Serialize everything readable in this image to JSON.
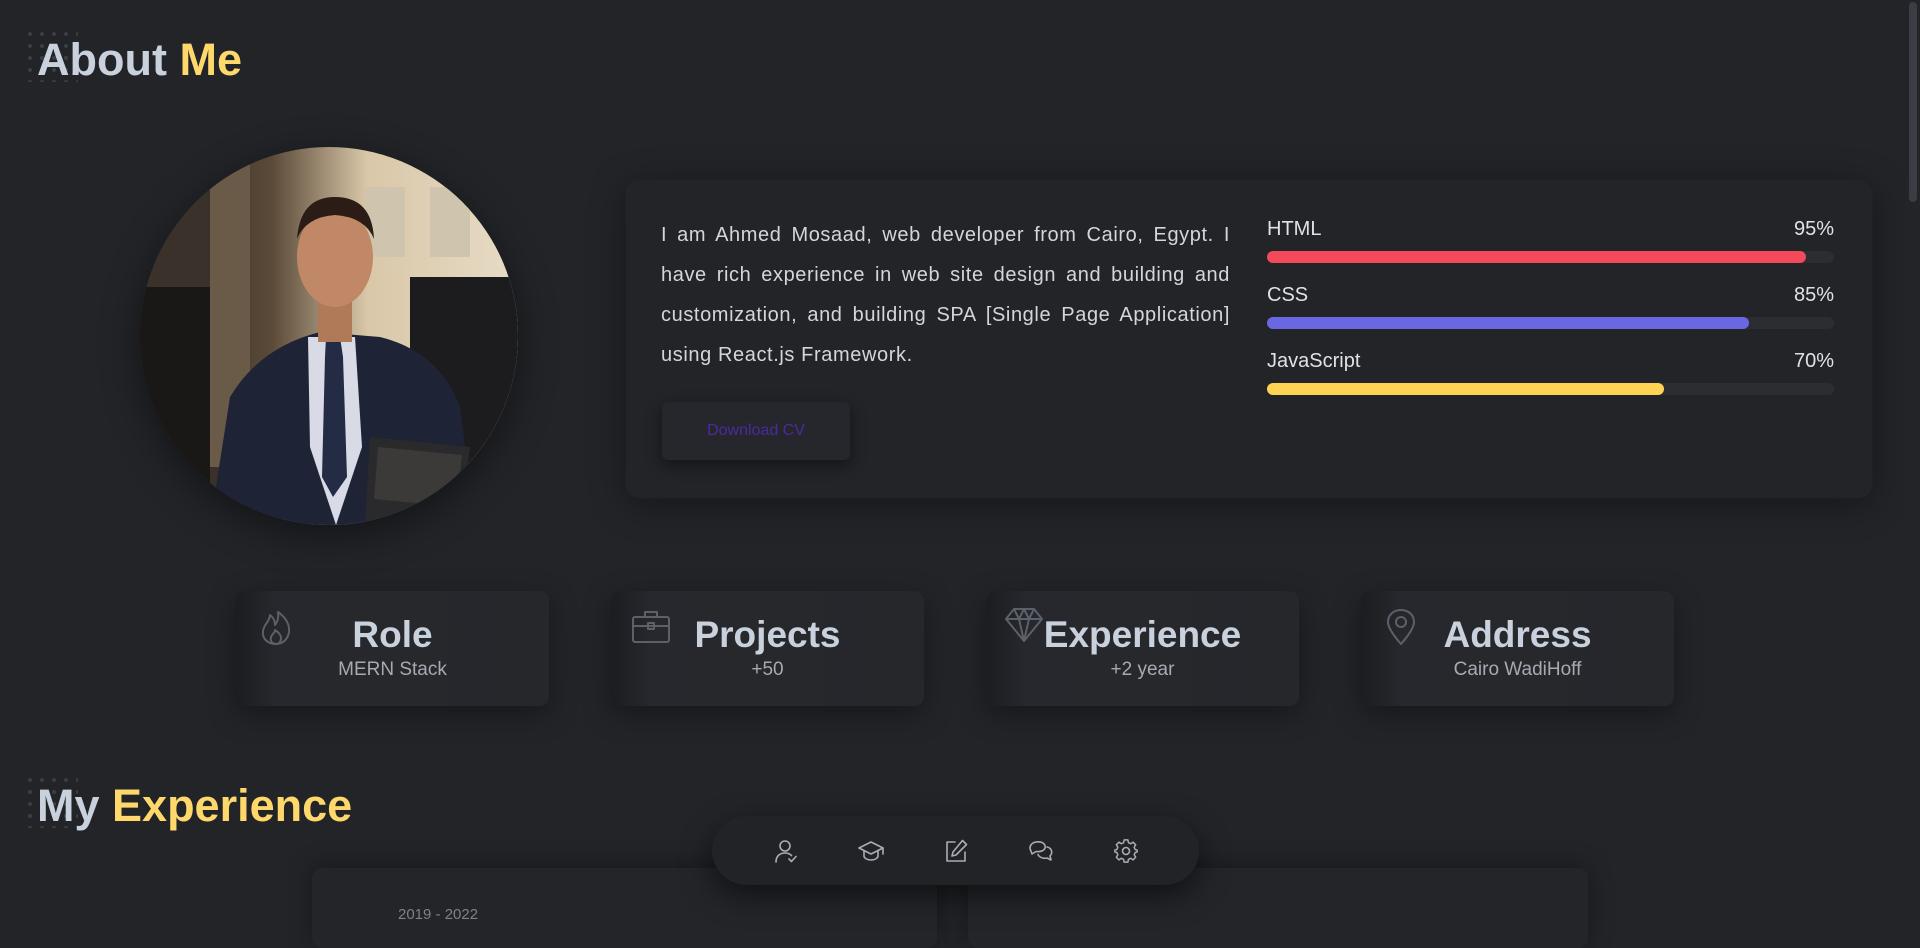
{
  "about": {
    "title_prefix": "About",
    "title_accent": "Me",
    "bio": "I am Ahmed Mosaad, web developer from Cairo, Egypt. I have rich experience in web site design and building and customization, and building SPA [Single Page Application] using React.js Framework.",
    "download_label": "Download CV"
  },
  "skills": [
    {
      "name": "HTML",
      "percent_label": "95%",
      "level": 95,
      "color": "#f4495a"
    },
    {
      "name": "CSS",
      "percent_label": "85%",
      "level": 85,
      "color": "#6a67e3"
    },
    {
      "name": "JavaScript",
      "percent_label": "70%",
      "level": 70,
      "color": "#ffd454"
    }
  ],
  "info_cards": [
    {
      "title": "Role",
      "value": "MERN Stack",
      "icon": "flame-icon"
    },
    {
      "title": "Projects",
      "value": "+50",
      "icon": "briefcase-icon"
    },
    {
      "title": "Experience",
      "value": "+2 year",
      "icon": "diamond-icon"
    },
    {
      "title": "Address",
      "value": "Cairo WadiHoff",
      "icon": "location-pin-icon"
    }
  ],
  "experience": {
    "title_prefix": "My",
    "title_accent": "Experience",
    "first_date": "2019 - 2022"
  },
  "bottom_nav": [
    {
      "icon": "user-icon"
    },
    {
      "icon": "graduation-cap-icon"
    },
    {
      "icon": "edit-icon"
    },
    {
      "icon": "chat-icon"
    },
    {
      "icon": "gear-icon"
    }
  ],
  "colors": {
    "background": "#222428",
    "accent": "#ffd86b",
    "heading": "#c9d1dd",
    "icon": "#5c6069"
  }
}
